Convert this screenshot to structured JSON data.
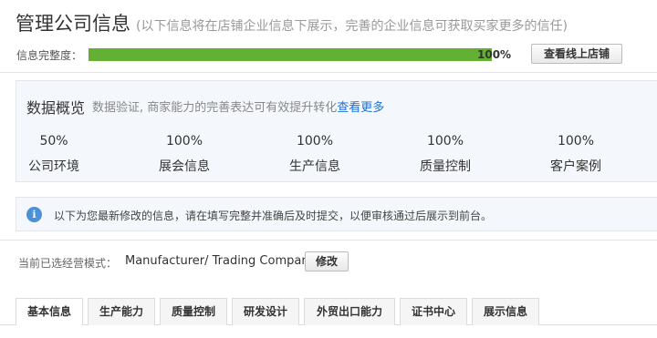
{
  "header": {
    "title": "管理公司信息",
    "subtitle": "(以下信息将在店铺企业信息下展示，完善的企业信息可获取买家更多的信任)"
  },
  "completeness": {
    "label": "信息完整度：",
    "percent_text": "100%",
    "progress_fraction": 1.0,
    "view_store_button": "查看线上店铺",
    "bar_color": "#63b032"
  },
  "overview": {
    "title": "数据概览",
    "description": "数据验证, 商家能力的完善表达可有效提升转化",
    "more_link": "查看更多",
    "stats": [
      {
        "value": "50%",
        "label": "公司环境"
      },
      {
        "value": "100%",
        "label": "展会信息"
      },
      {
        "value": "100%",
        "label": "生产信息"
      },
      {
        "value": "100%",
        "label": "质量控制"
      },
      {
        "value": "100%",
        "label": "客户案例"
      }
    ]
  },
  "notice": {
    "icon": "info-icon",
    "message": "以下为您最新修改的信息，请在填写完整并准确后及时提交，以便审核通过后展示到前台。"
  },
  "business_mode": {
    "label": "当前已选经营模式：",
    "value": "Manufacturer/ Trading Company",
    "edit_button": "修改"
  },
  "tabs": [
    {
      "label": "基本信息",
      "active": true
    },
    {
      "label": "生产能力",
      "active": false
    },
    {
      "label": "质量控制",
      "active": false
    },
    {
      "label": "研发设计",
      "active": false
    },
    {
      "label": "外贸出口能力",
      "active": false
    },
    {
      "label": "证书中心",
      "active": false
    },
    {
      "label": "展示信息",
      "active": false
    }
  ]
}
